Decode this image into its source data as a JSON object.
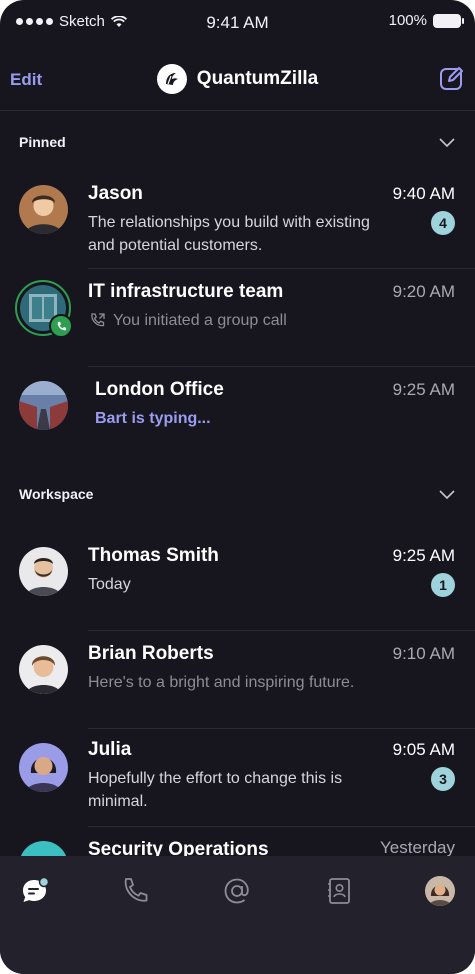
{
  "status_bar": {
    "carrier": "Sketch",
    "time": "9:41 AM",
    "battery": "100%"
  },
  "header": {
    "edit_label": "Edit",
    "title": "QuantumZilla"
  },
  "sections": {
    "pinned": "Pinned",
    "workspace": "Workspace"
  },
  "chats": [
    {
      "name": "Jason",
      "time": "9:40 AM",
      "preview": "The relationships you build with existing and potential customers.",
      "unread": "4"
    },
    {
      "name": "IT infrastructure team",
      "time": "9:20 AM",
      "preview": "You initiated a group call"
    },
    {
      "name": "London Office",
      "time": "9:25 AM",
      "preview": "Bart is typing..."
    },
    {
      "name": "Thomas Smith",
      "time": "9:25 AM",
      "preview": "Today",
      "unread": "1"
    },
    {
      "name": "Brian Roberts",
      "time": "9:10 AM",
      "preview": "Here's to a bright and inspiring future."
    },
    {
      "name": "Julia",
      "time": "9:05 AM",
      "preview": "Hopefully the effort to change this is minimal.",
      "unread": "3"
    },
    {
      "name": "Security Operations",
      "time": "Yesterday"
    }
  ],
  "colors": {
    "accent": "#9b9cf0",
    "badge": "#9fd3dc",
    "background": "#17161f",
    "tabbar": "#23222c",
    "call_green": "#2e9e4f"
  },
  "tab_icons": [
    "chat-icon",
    "phone-icon",
    "at-icon",
    "contacts-icon",
    "profile-avatar"
  ]
}
